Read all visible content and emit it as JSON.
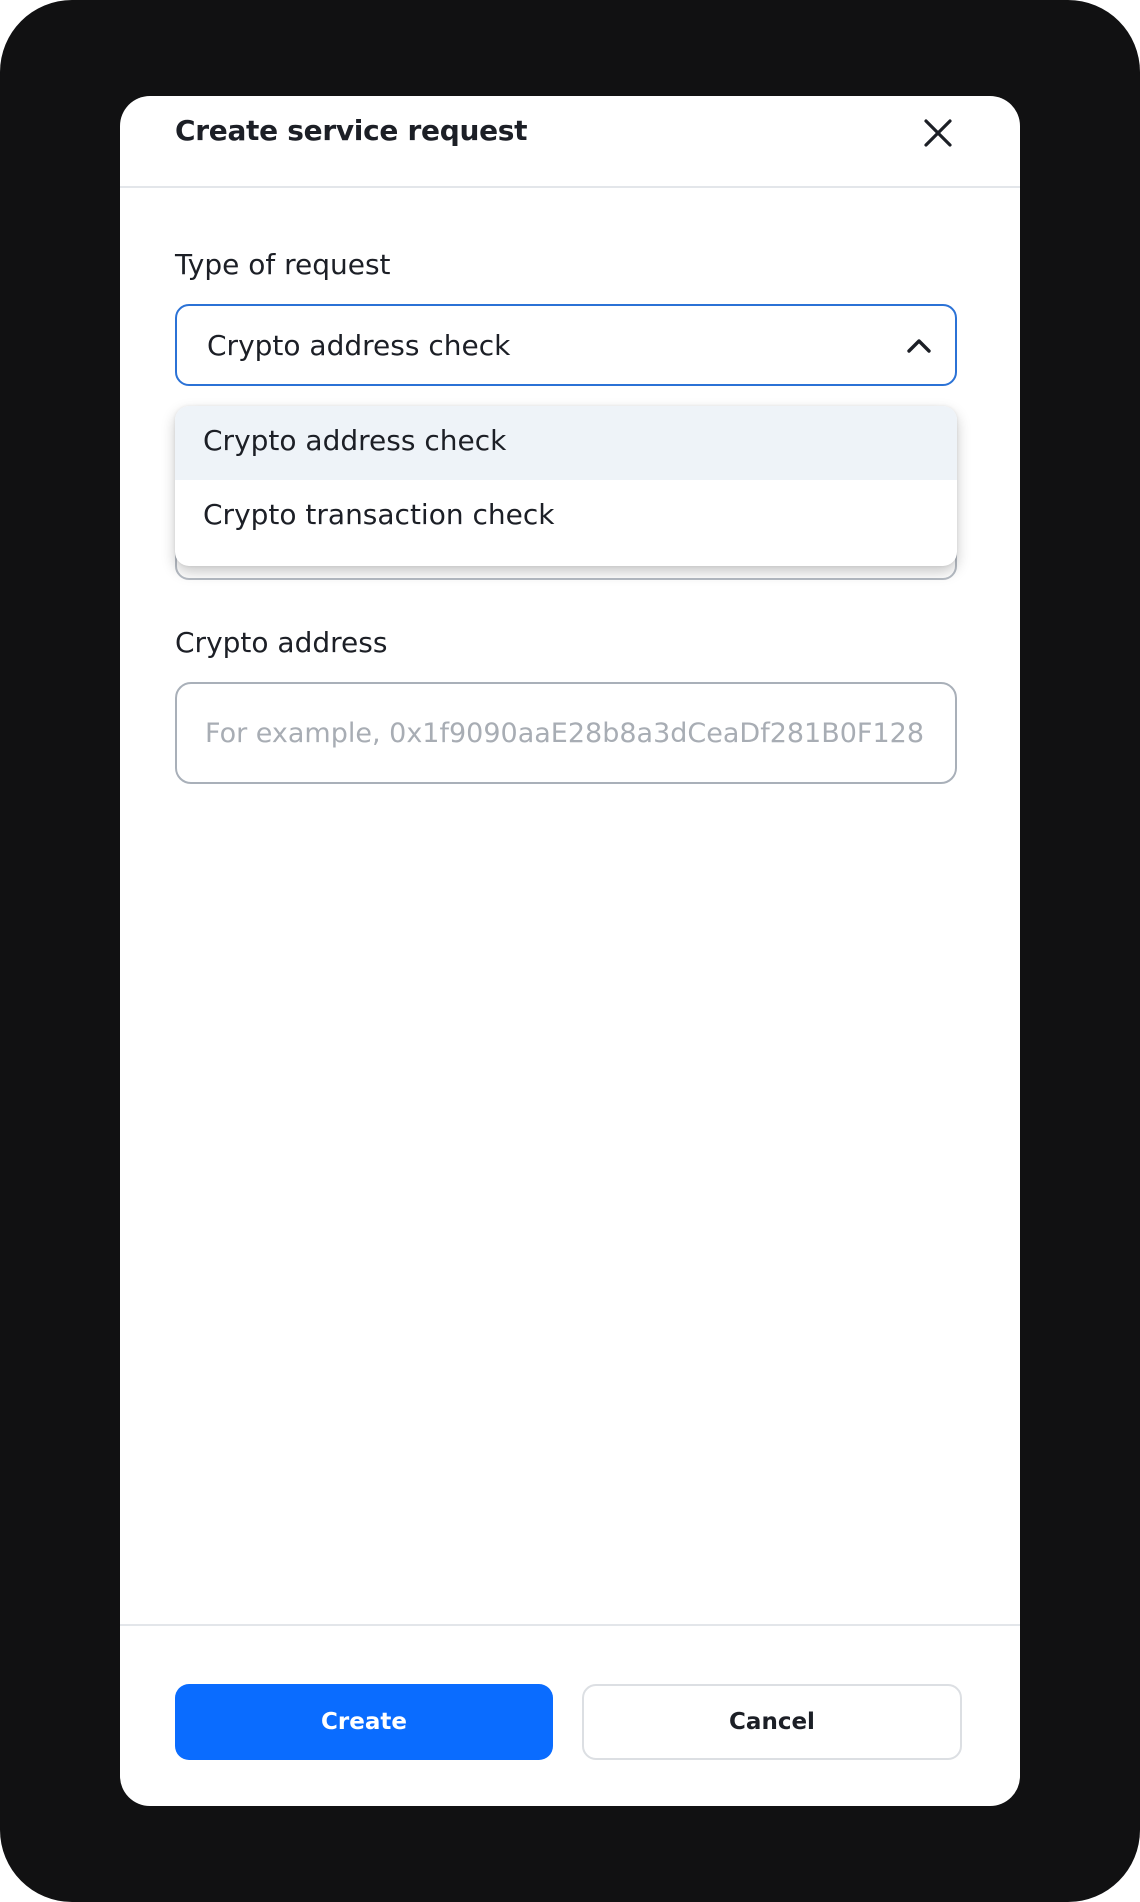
{
  "modal": {
    "title": "Create service request",
    "close_icon": "close-icon"
  },
  "type_field": {
    "label": "Type of request",
    "selected_value": "Crypto address check",
    "chevron_icon": "chevron-up-icon",
    "options": [
      {
        "label": "Crypto address check",
        "selected": true
      },
      {
        "label": "Crypto transaction check",
        "selected": false
      }
    ]
  },
  "address_field": {
    "label": "Crypto address",
    "value": "",
    "placeholder": "For example, 0x1f9090aaE28b8a3dCeaDf281B0F128"
  },
  "footer": {
    "create_label": "Create",
    "cancel_label": "Cancel"
  },
  "colors": {
    "accent": "#0a6cff",
    "focus_border": "#2b72d6",
    "option_highlight": "#eef3f8",
    "device_frame": "#111112"
  }
}
